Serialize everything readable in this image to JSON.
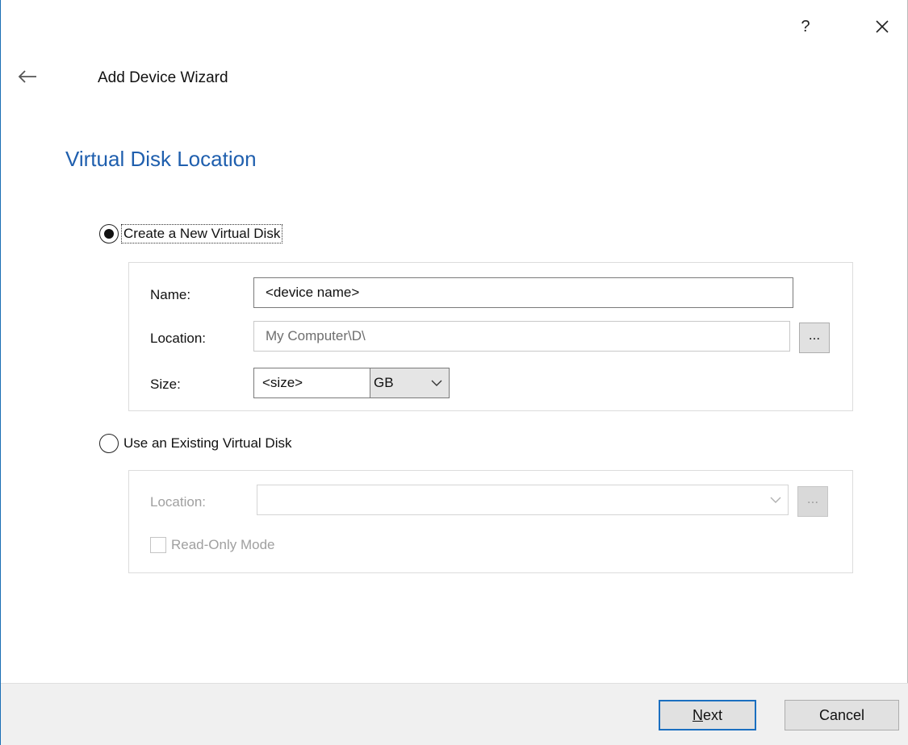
{
  "window": {
    "help_label": "?",
    "wizard_title": "Add Device Wizard"
  },
  "page": {
    "heading": "Virtual Disk Location"
  },
  "new_disk": {
    "radio_label": "Create a New Virtual Disk",
    "selected": true,
    "name_label": "Name:",
    "name_value": "<device name>",
    "location_label": "Location:",
    "location_value": "My Computer\\D\\",
    "browse_label": "...",
    "size_label": "Size:",
    "size_value": "<size>",
    "size_unit": "GB"
  },
  "existing_disk": {
    "radio_label": "Use an Existing Virtual Disk",
    "selected": false,
    "location_label": "Location:",
    "location_value": "",
    "browse_label": "...",
    "readonly_label": "Read-Only Mode"
  },
  "footer": {
    "next_mnemonic": "N",
    "next_rest": "ext",
    "cancel_label": "Cancel"
  },
  "colors": {
    "heading": "#1f5fae",
    "default_button_border": "#1a6fc0",
    "footer_bg": "#f0f0f0"
  }
}
